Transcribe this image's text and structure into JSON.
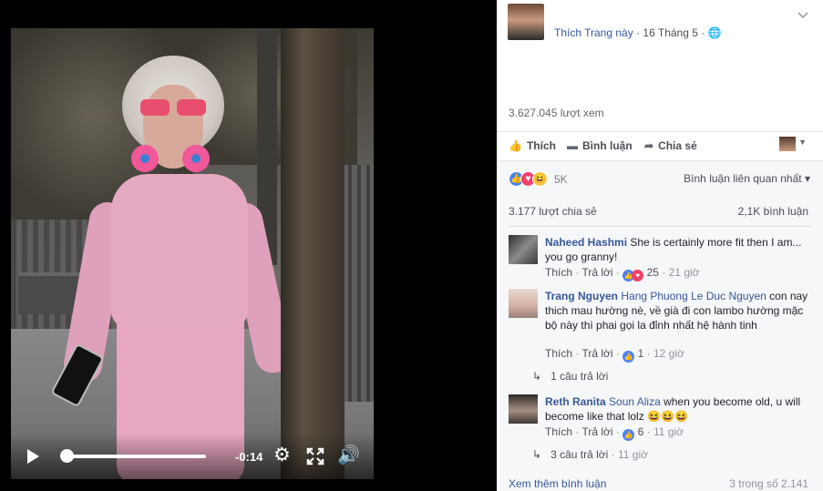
{
  "video": {
    "time_remaining": "-0:14",
    "progress_fraction": 0.04
  },
  "post": {
    "page_name": "Thích Trang này",
    "separator": "·",
    "date": "16 Tháng 5",
    "dot": "·",
    "views": "3.627.045 lượt xem"
  },
  "actions": {
    "like": "Thích",
    "comment": "Bình luận",
    "share": "Chia sẻ"
  },
  "stats": {
    "reactions_count": "5K",
    "sort_label": "Bình luận liên quan nhất",
    "sort_caret": "▾",
    "shares": "3.177 lượt chia sẻ",
    "comments": "2,1K bình luận"
  },
  "comments": [
    {
      "author": "Naheed Hashmi",
      "tag": "",
      "text": "She is certainly more fit then I am... you go granny!",
      "like": "Thích",
      "reply": "Trả lời",
      "reaction_count": "25",
      "time": "21 giờ",
      "replies_label": "",
      "replies_time": ""
    },
    {
      "author": "Trang Nguyen",
      "tag": "Hang Phuong Le Duc Nguyen",
      "text": "con nay thich mau hường nè, về già đi con lambo hường mặc bộ này thì phai gọi la đỉnh nhất hệ hành tinh",
      "like": "Thích",
      "reply": "Trả lời",
      "reaction_count": "1",
      "time": "12 giờ",
      "replies_label": "1 câu trả lời",
      "replies_time": ""
    },
    {
      "author": "Reth Ranita",
      "tag": "Soun Aliza",
      "text": "when you become old, u will become like that lolz 😆😆😆",
      "like": "Thích",
      "reply": "Trả lời",
      "reaction_count": "6",
      "time": "11 giờ",
      "replies_label": "3 câu trả lời",
      "replies_time": "11 giờ"
    }
  ],
  "footer": {
    "more": "Xem thêm bình luận",
    "pager": "3 trong số 2.141"
  },
  "meta_sep": "·",
  "icons": {
    "play": "play-icon",
    "settings": "gear-icon",
    "fullscreen": "fullscreen-icon",
    "volume": "volume-icon",
    "like": "thumbs-up-icon",
    "comment": "speech-bubble-icon",
    "share": "share-arrow-icon",
    "reply_arrow": "reply-arrow-icon"
  },
  "colors": {
    "link": "#365899",
    "like_blue": "#4c83f3",
    "love_red": "#f0416a",
    "haha_yellow": "#f6c54a"
  }
}
